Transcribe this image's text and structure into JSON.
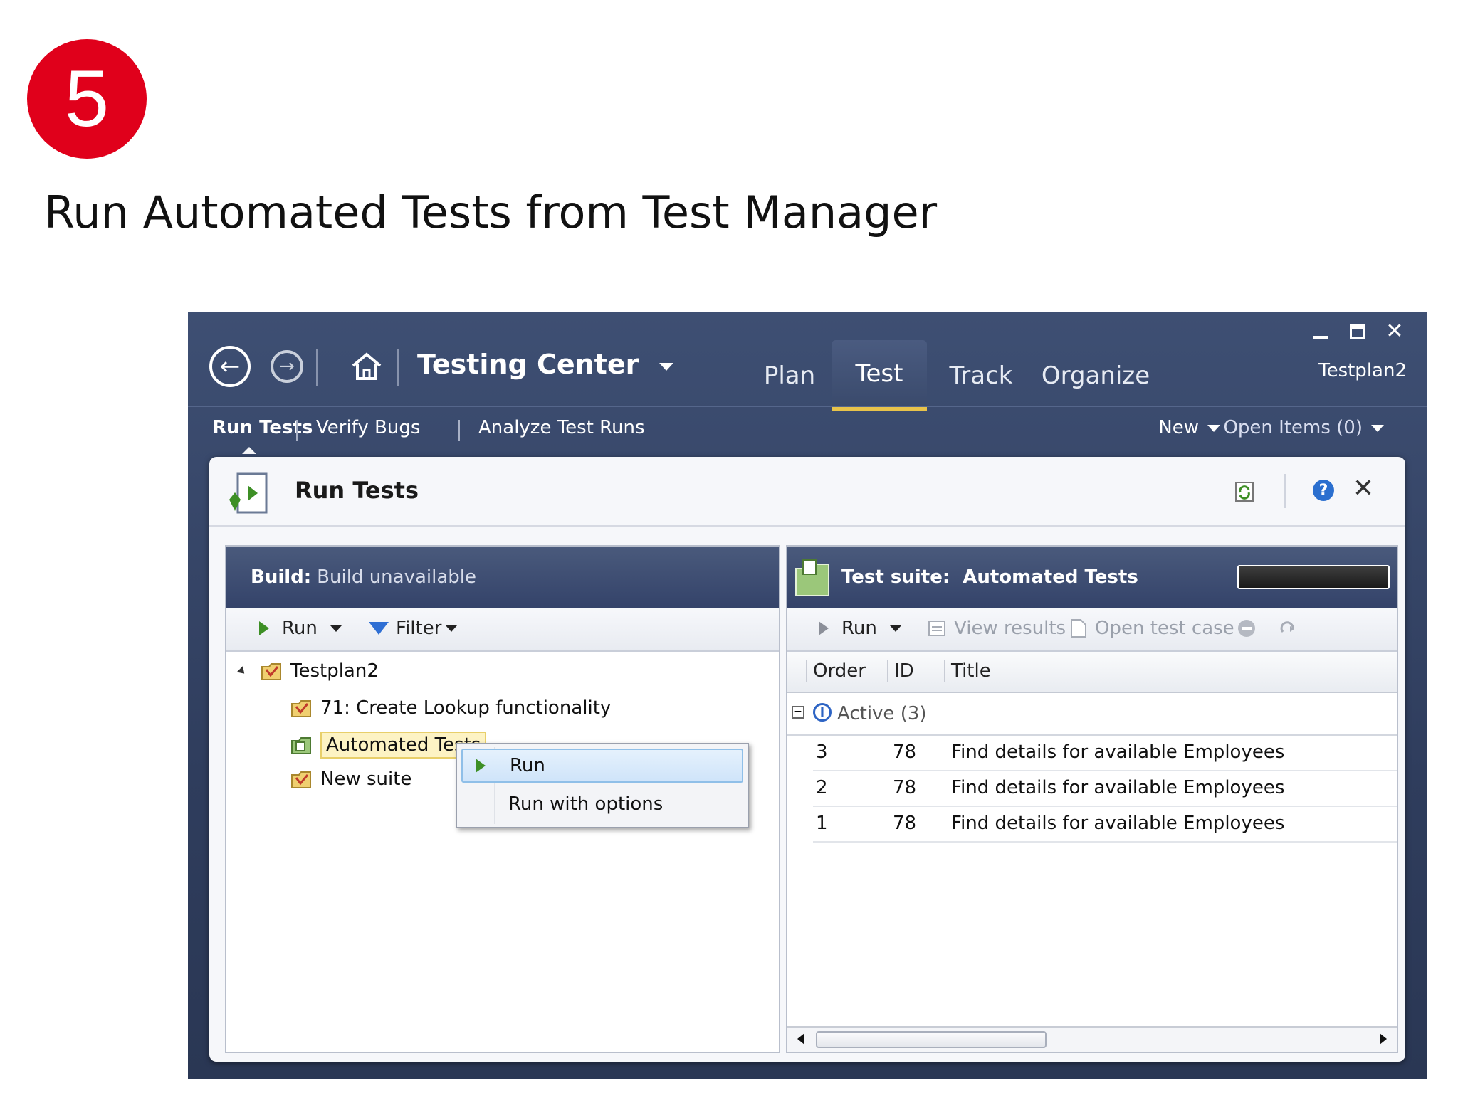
{
  "slide": {
    "step_number": "5",
    "title": "Run Automated Tests from Test Manager"
  },
  "window_controls": {
    "minimize": "",
    "maximize": "",
    "close": "✕"
  },
  "nav": {
    "app_title": "Testing Center",
    "tabs": [
      "Plan",
      "Test",
      "Track",
      "Organize"
    ],
    "active_tab": "Test",
    "plan_name": "Testplan2"
  },
  "subnav": {
    "items": [
      "Run Tests",
      "Verify Bugs",
      "Analyze Test Runs"
    ],
    "new_label": "New",
    "open_items_label": "Open Items (0)"
  },
  "card": {
    "title": "Run Tests"
  },
  "left_pane": {
    "build_label": "Build:",
    "build_value": "Build unavailable",
    "run_label": "Run",
    "filter_label": "Filter",
    "tree": {
      "root": "Testplan2",
      "children": [
        "71: Create Lookup functionality",
        "Automated Tests",
        "New suite"
      ]
    }
  },
  "context_menu": {
    "items": [
      "Run",
      "Run with options"
    ]
  },
  "right_pane": {
    "suite_label": "Test suite:",
    "suite_name": "Automated Tests",
    "toolbar": {
      "run": "Run",
      "view_results": "View results",
      "open_test_case": "Open test case"
    },
    "columns": [
      "Order",
      "ID",
      "Title"
    ],
    "group": {
      "label": "Active (3)"
    },
    "rows": [
      {
        "order": "3",
        "id": "78",
        "title": "Find details for available Employees"
      },
      {
        "order": "2",
        "id": "78",
        "title": "Find details for available Employees"
      },
      {
        "order": "1",
        "id": "78",
        "title": "Find details for available Employees"
      }
    ]
  },
  "colors": {
    "badge": "#e0001b",
    "window_bg": "#34436a",
    "active_tab_underline": "#e8c34a",
    "selection": "#fdf3c4"
  }
}
